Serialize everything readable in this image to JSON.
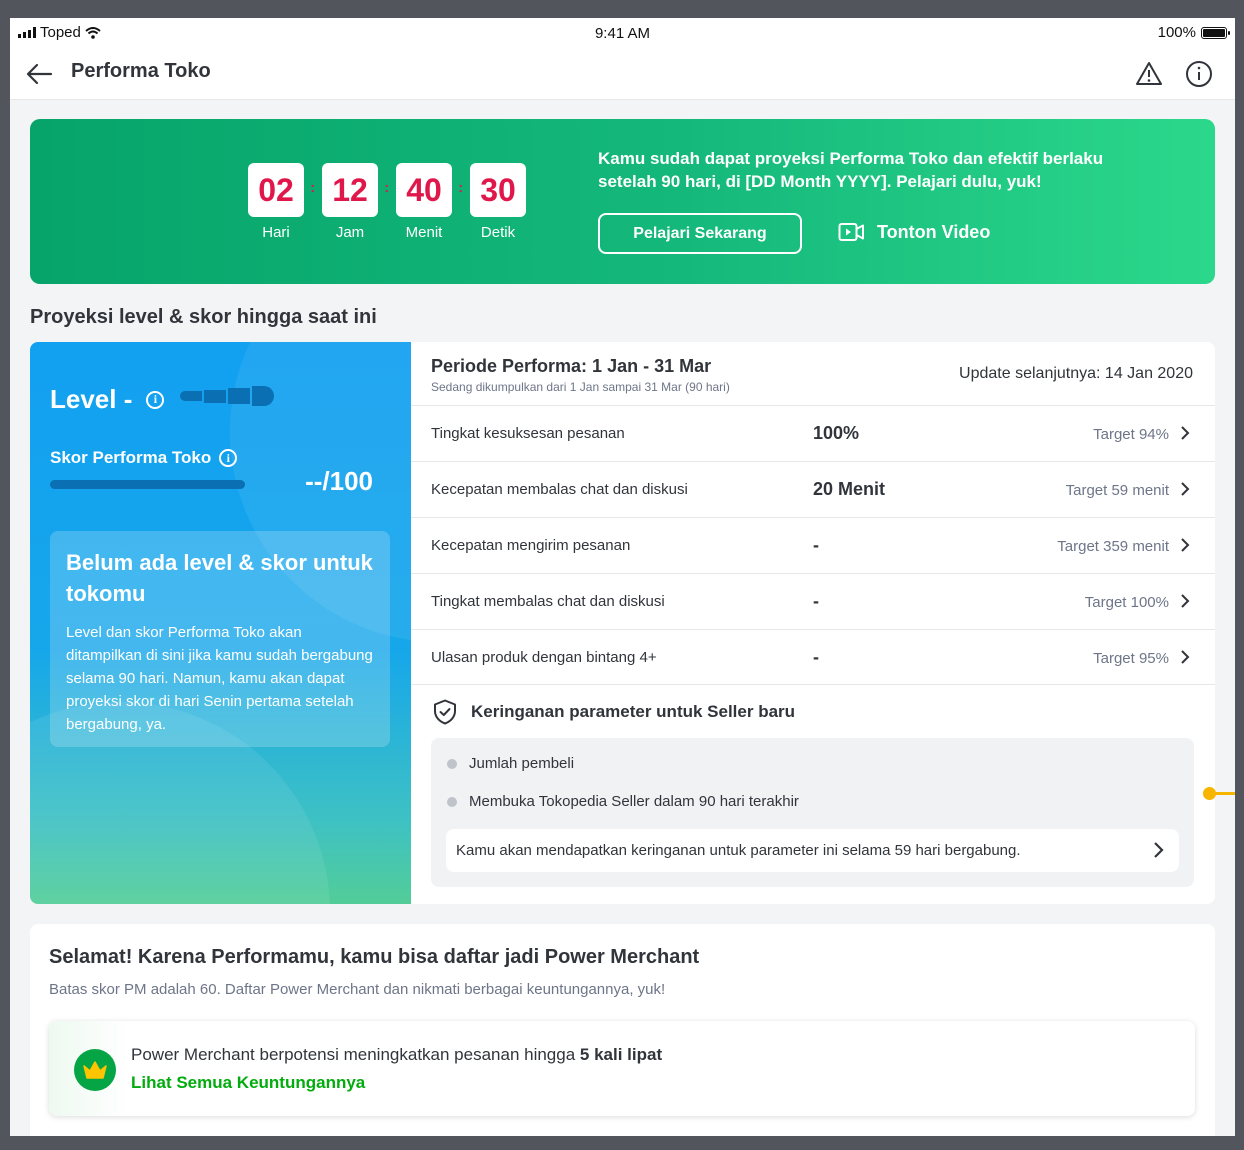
{
  "status_bar": {
    "carrier": "Toped",
    "time": "9:41 AM",
    "battery": "100%"
  },
  "header": {
    "title": "Performa Toko"
  },
  "banner": {
    "countdown": [
      {
        "value": "02",
        "label": "Hari"
      },
      {
        "value": "12",
        "label": "Jam"
      },
      {
        "value": "40",
        "label": "Menit"
      },
      {
        "value": "30",
        "label": "Detik"
      }
    ],
    "message": "Kamu sudah dapat proyeksi Performa Toko dan efektif berlaku setelah 90 hari, di [DD Month YYYY]. Pelajari dulu, yuk!",
    "primary_button": "Pelajari Sekarang",
    "video_link": "Tonton Video"
  },
  "section_title": "Proyeksi level & skor hingga saat ini",
  "level_card": {
    "level_label": "Level -",
    "skor_label": "Skor Performa Toko",
    "skor_value": "--/100",
    "empty_title": "Belum ada level & skor untuk tokomu",
    "empty_desc": "Level dan skor Performa Toko akan ditampilkan di sini jika kamu sudah bergabung selama 90 hari. Namun, kamu akan dapat proyeksi skor di hari Senin pertama setelah bergabung, ya."
  },
  "metrics": {
    "periode_title": "Periode Performa: 1 Jan - 31 Mar",
    "periode_sub": "Sedang dikumpulkan dari 1 Jan sampai 31 Mar (90 hari)",
    "update_text": "Update selanjutnya: 14 Jan 2020",
    "rows": [
      {
        "label": "Tingkat kesuksesan pesanan",
        "value": "100%",
        "target": "Target 94%"
      },
      {
        "label": "Kecepatan membalas chat dan diskusi",
        "value": "20 Menit",
        "target": "Target 59 menit"
      },
      {
        "label": "Kecepatan mengirim pesanan",
        "value": "-",
        "target": "Target 359 menit"
      },
      {
        "label": "Tingkat membalas chat dan diskusi",
        "value": "-",
        "target": "Target 100%"
      },
      {
        "label": "Ulasan produk dengan bintang 4+",
        "value": "-",
        "target": "Target 95%"
      }
    ],
    "keringanan_title": "Keringanan parameter untuk Seller baru",
    "keringanan_items": [
      "Jumlah pembeli",
      "Membuka Tokopedia Seller dalam 90 hari terakhir"
    ],
    "keringanan_notice": "Kamu akan mendapatkan keringanan untuk parameter ini selama 59 hari bergabung."
  },
  "pm_card": {
    "title": "Selamat! Karena Performamu, kamu bisa daftar jadi Power Merchant",
    "subtitle": "Batas skor PM adalah 60. Daftar Power Merchant dan nikmati berbagai keuntungannya, yuk!",
    "text_prefix": "Power Merchant berpotensi meningkatkan pesanan hingga ",
    "text_bold": "5 kali lipat",
    "link": "Lihat Semua Keuntungannya"
  },
  "colors": {
    "brand_green": "#03ac0e",
    "countdown_red": "#e0174a",
    "level_blue": "#12a0f1",
    "annotation": "#f7b500"
  }
}
